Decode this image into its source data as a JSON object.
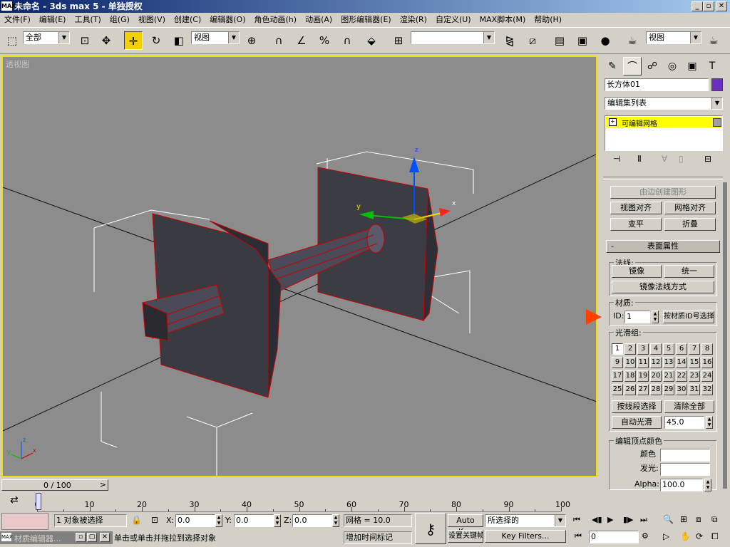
{
  "window": {
    "title": "未命名 - 3ds max 5 - 单独授权",
    "app_icon": "MAX"
  },
  "menu": [
    "文件(F)",
    "编辑(E)",
    "工具(T)",
    "组(G)",
    "视图(V)",
    "创建(C)",
    "编辑器(O)",
    "角色动画(h)",
    "动画(A)",
    "图形编辑器(E)",
    "渲染(R)",
    "自定义(U)",
    "MAX脚本(M)",
    "帮助(H)"
  ],
  "toolbar": {
    "selection_filter": "全部",
    "ref_coord": "视图",
    "named_selection": "",
    "render_view": "视图",
    "mirror_icon": "mirror-icon",
    "move_icon": "move-icon"
  },
  "viewport": {
    "label": "透视图",
    "axis_x": "x",
    "axis_y": "y",
    "axis_z": "z"
  },
  "command_panel": {
    "object_name": "长方体01",
    "modifier_list": "编辑集列表",
    "stack_item": "可编辑网格",
    "stack_toggle": "+",
    "buttons_top": {
      "create_shape": "由边创建图形",
      "view_align": "视图对齐",
      "grid_align": "网格对齐",
      "flatten": "变平",
      "collapse": "折叠"
    },
    "rollout_title": "表面属性",
    "rollout_toggle": "-",
    "normals": {
      "label": "法线:",
      "flip": "镜像",
      "unify": "统一",
      "flip_mode": "镜像法线方式"
    },
    "material": {
      "label": "材质:",
      "id_label": "ID:",
      "id_value": "1",
      "select_by_id": "按材质ID号选择"
    },
    "smoothing": {
      "label": "光滑组:",
      "groups": [
        "1",
        "2",
        "3",
        "4",
        "5",
        "6",
        "7",
        "8",
        "9",
        "10",
        "11",
        "12",
        "13",
        "14",
        "15",
        "16",
        "17",
        "18",
        "19",
        "20",
        "21",
        "22",
        "23",
        "24",
        "25",
        "26",
        "27",
        "28",
        "29",
        "30",
        "31",
        "32"
      ],
      "select_by": "按线段选择",
      "clear_all": "清除全部",
      "auto_smooth": "自动光滑",
      "threshold": "45.0"
    },
    "vertex_colors": {
      "label": "编辑顶点颜色",
      "color": "颜色",
      "illum": "发光:",
      "alpha_label": "Alpha:",
      "alpha_value": "100.0"
    }
  },
  "timeline": {
    "frame": "0 / 100",
    "ticks": [
      "0",
      "10",
      "20",
      "30",
      "40",
      "50",
      "60",
      "70",
      "80",
      "90",
      "100"
    ]
  },
  "status": {
    "mat_editor": "材质编辑器...",
    "selected": "1 对象被选择",
    "prompt": "单击或单击并拖拉到选择对象",
    "x_label": "X:",
    "x": "0.0",
    "y_label": "Y:",
    "y": "0.0",
    "z_label": "Z:",
    "z": "0.0",
    "grid": "网格 = 10.0",
    "add_time_tag": "增加时间标记",
    "auto_key": "Auto Key",
    "selected_set": "所选择的",
    "set_key": "设置关键帧",
    "key_filters": "Key Filters...",
    "current_frame": "0"
  },
  "colors": {
    "title_start": "#0a246a",
    "title_end": "#a6caf0",
    "viewport_bg": "#8c8c8c",
    "viewport_border": "#f0e000",
    "object_color": "#6a2fc0",
    "stack_highlight": "#ffff00"
  }
}
